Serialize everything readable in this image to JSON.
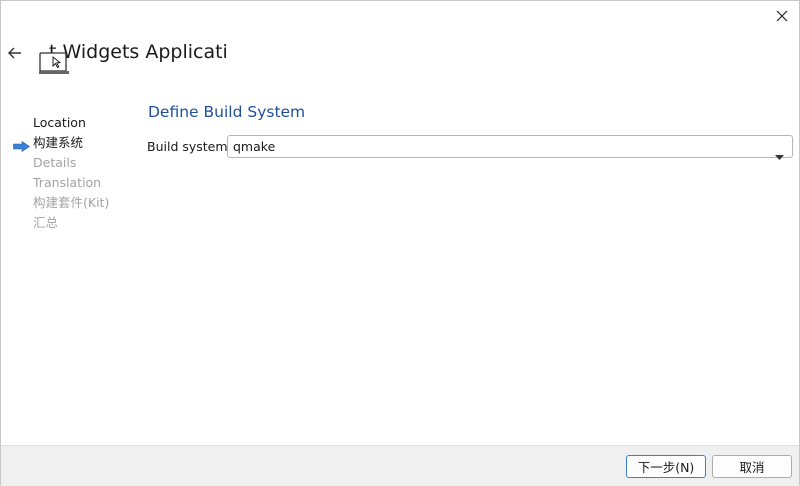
{
  "window": {
    "title": "t Widgets Applicatic"
  },
  "steps": [
    {
      "label": "Location",
      "state": "done"
    },
    {
      "label": "构建系统",
      "state": "current"
    },
    {
      "label": "Details",
      "state": "todo"
    },
    {
      "label": "Translation",
      "state": "todo"
    },
    {
      "label": "构建套件(Kit)",
      "state": "todo"
    },
    {
      "label": "汇总",
      "state": "todo"
    }
  ],
  "page": {
    "heading": "Define Build System",
    "build_system_label": "Build system:",
    "build_system_value": "qmake"
  },
  "footer": {
    "next_label": "下一步(N)",
    "cancel_label": "取消"
  },
  "icons": {
    "close": "close-icon",
    "back": "arrow-left-icon",
    "app": "laptop-icon",
    "current_step": "arrow-right-icon",
    "dropdown": "chevron-down-icon"
  },
  "colors": {
    "heading": "#1f4e9c",
    "step_arrow": "#3b82d6",
    "disabled_text": "#a3a3a3",
    "footer_bg": "#f0f0f0"
  }
}
